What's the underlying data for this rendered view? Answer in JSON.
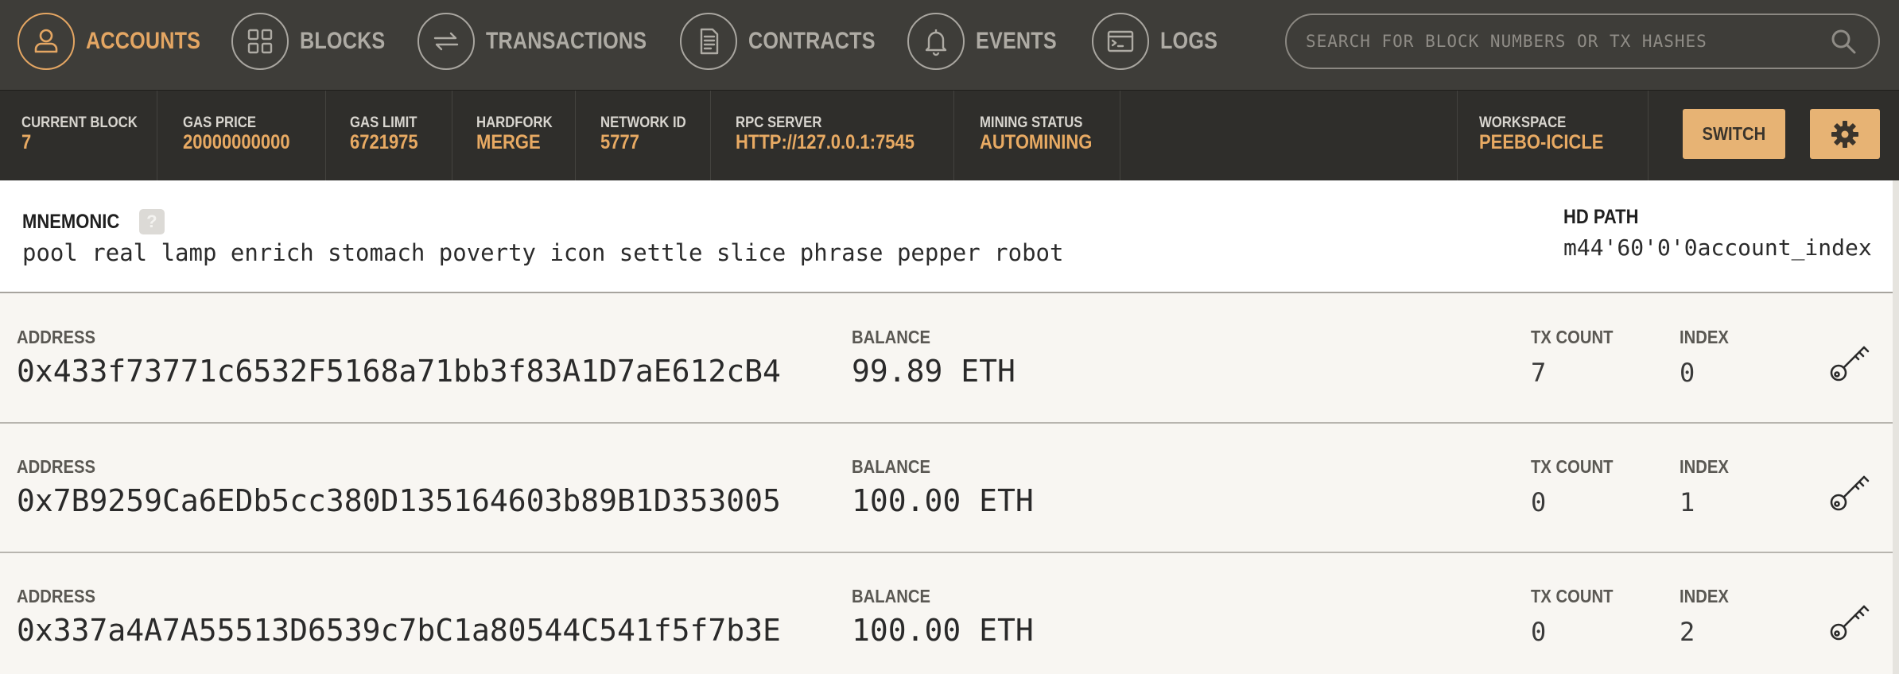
{
  "nav": {
    "items": [
      {
        "label": "ACCOUNTS",
        "icon": "user-icon",
        "active": true
      },
      {
        "label": "BLOCKS",
        "icon": "grid-icon",
        "active": false
      },
      {
        "label": "TRANSACTIONS",
        "icon": "swap-arrows-icon",
        "active": false
      },
      {
        "label": "CONTRACTS",
        "icon": "document-icon",
        "active": false
      },
      {
        "label": "EVENTS",
        "icon": "bell-icon",
        "active": false
      },
      {
        "label": "LOGS",
        "icon": "terminal-icon",
        "active": false
      }
    ],
    "search_placeholder": "SEARCH FOR BLOCK NUMBERS OR TX HASHES"
  },
  "status": {
    "current_block": {
      "label": "CURRENT BLOCK",
      "value": "7"
    },
    "gas_price": {
      "label": "GAS PRICE",
      "value": "20000000000"
    },
    "gas_limit": {
      "label": "GAS LIMIT",
      "value": "6721975"
    },
    "hardfork": {
      "label": "HARDFORK",
      "value": "MERGE"
    },
    "network_id": {
      "label": "NETWORK ID",
      "value": "5777"
    },
    "rpc_server": {
      "label": "RPC SERVER",
      "value": "HTTP://127.0.0.1:7545"
    },
    "mining_status": {
      "label": "MINING STATUS",
      "value": "AUTOMINING"
    },
    "workspace": {
      "label": "WORKSPACE",
      "value": "PEEBO-ICICLE"
    },
    "switch_label": "SWITCH"
  },
  "mnemonic": {
    "label": "MNEMONIC",
    "help": "?",
    "words": "pool real lamp enrich stomach poverty icon settle slice phrase pepper robot",
    "hd_path_label": "HD PATH",
    "hd_path_value": "m44'60'0'0account_index"
  },
  "accounts": {
    "address_label": "ADDRESS",
    "balance_label": "BALANCE",
    "tx_count_label": "TX COUNT",
    "index_label": "INDEX",
    "rows": [
      {
        "address": "0x433f73771c6532F5168a71bb3f83A1D7aE612cB4",
        "balance": "99.89 ETH",
        "tx_count": "7",
        "index": "0"
      },
      {
        "address": "0x7B9259Ca6EDb5cc380D135164603b89B1D353005",
        "balance": "100.00 ETH",
        "tx_count": "0",
        "index": "1"
      },
      {
        "address": "0x337a4A7A55513D6539c7bC1a80544C541f5f7b3E",
        "balance": "100.00 ETH",
        "tx_count": "0",
        "index": "2"
      }
    ]
  },
  "colors": {
    "accent": "#e4a663",
    "nav_bg": "#3e3d39",
    "status_bg": "#2f2e2b",
    "button_bg": "#e7b374"
  }
}
